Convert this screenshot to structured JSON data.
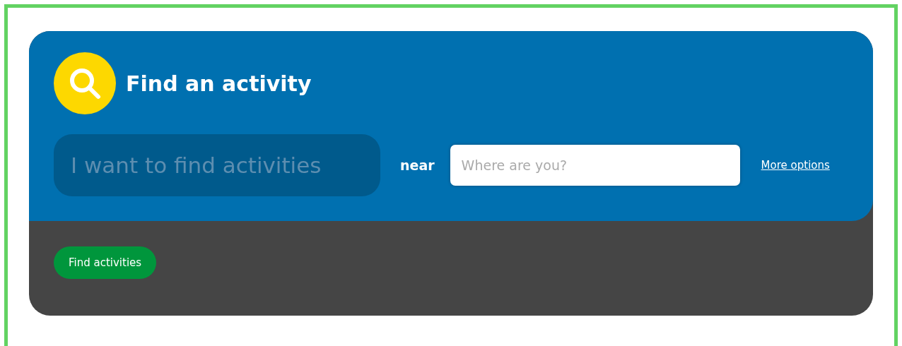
{
  "search_panel": {
    "title": "Find an activity",
    "activity_field": {
      "placeholder": "I want to find activities"
    },
    "near_label": "near",
    "location_field": {
      "placeholder": "Where are you?"
    },
    "more_options_link": "More options"
  },
  "find_button": "Find activities"
}
